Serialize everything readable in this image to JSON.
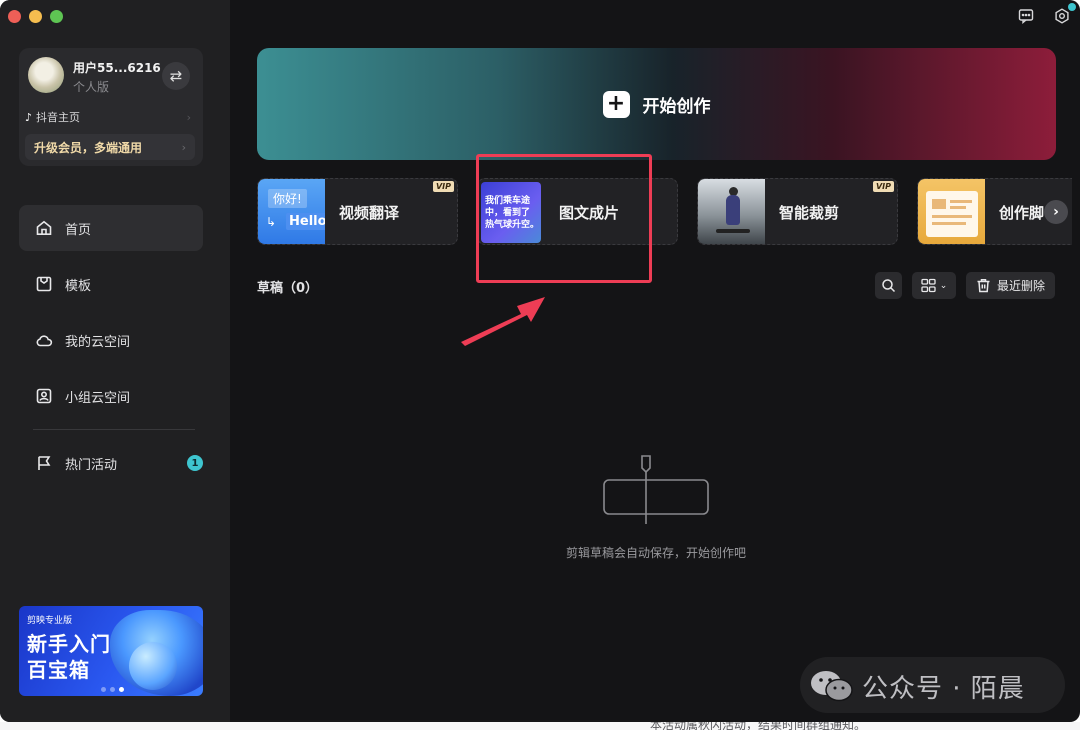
{
  "user": {
    "name": "用户55...6216",
    "plan": "个人版",
    "douyin_label": "抖音主页",
    "upgrade_label": "升级会员，多端通用"
  },
  "nav": {
    "items": [
      {
        "label": "首页",
        "icon": "home-icon",
        "active": true
      },
      {
        "label": "模板",
        "icon": "template-icon",
        "active": false
      },
      {
        "label": "我的云空间",
        "icon": "cloud-icon",
        "active": false
      },
      {
        "label": "小组云空间",
        "icon": "team-cloud-icon",
        "active": false
      }
    ],
    "events": {
      "label": "热门活动",
      "icon": "flag-icon",
      "badge": "1"
    }
  },
  "promo": {
    "brand": "剪映专业版",
    "title_line1": "新手入门",
    "title_line2": "百宝箱"
  },
  "create": {
    "label": "开始创作"
  },
  "tools": [
    {
      "label": "视频翻译",
      "vip": "VIP",
      "thumb_text_top": "你好!",
      "thumb_text_bottom": "Hello"
    },
    {
      "label": "图文成片",
      "thumb_lines": [
        "我们乘车途",
        "中，看到了",
        "热气球升空。"
      ]
    },
    {
      "label": "智能裁剪",
      "vip": "VIP"
    },
    {
      "label": "创作脚"
    }
  ],
  "drafts": {
    "title": "草稿（0）",
    "delete_label": "最近删除",
    "empty_text": "剪辑草稿会自动保存，开始创作吧"
  },
  "watermark": {
    "text": "公众号 · 陌晨"
  },
  "bottom_text": "本活动属秋闪活动，结果时间群组通知。",
  "colors": {
    "accent_red": "#ee3d55",
    "badge_cyan": "#3ec5cf"
  }
}
